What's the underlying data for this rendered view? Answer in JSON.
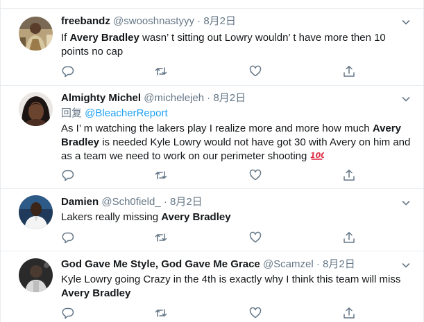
{
  "colors": {
    "text": "#14171a",
    "secondary": "#657786",
    "link": "#1da1f2",
    "divider": "#e6ecf0",
    "emoji_red": "#dd2e44"
  },
  "icons": [
    "reply-icon",
    "retweet-icon",
    "like-icon",
    "share-icon",
    "chevron-down-icon",
    "hundred-points-emoji"
  ],
  "tweets": [
    {
      "name": "freebandz",
      "handle": "@swooshnastyyy",
      "sep": "·",
      "date": "8月2日",
      "text_1": "If ",
      "bold_1": "Avery Bradley",
      "text_2": " wasn’ t sitting out Lowry wouldn’ t have more then 10 points no cap"
    },
    {
      "name": "Almighty Michel",
      "handle": "@michelejeh",
      "sep": "·",
      "date": "8月2日",
      "reply_prefix": "回复 ",
      "reply_mention": "@BleacherReport",
      "text_1": "As I’ m watching the lakers play I realize more and more how much ",
      "bold_1": "Avery Bradley",
      "text_2": " is needed Kyle Lowry would not have got 30 with Avery on him and as a team we need to work on our perimeter shooting ",
      "emoji": "hundred-points-emoji"
    },
    {
      "name": "Damien",
      "handle": "@Sch0field_",
      "sep": "·",
      "date": "8月2日",
      "text_1": "Lakers really missing ",
      "bold_1": "Avery Bradley"
    },
    {
      "name": "God Gave Me Style, God Gave Me Grace",
      "handle": "@Scamzel",
      "sep": "·",
      "date": "8月2日",
      "text_1": "Kyle Lowry going Crazy in the 4th is exactly why I think this team will miss ",
      "bold_1": "Avery Bradley"
    }
  ]
}
